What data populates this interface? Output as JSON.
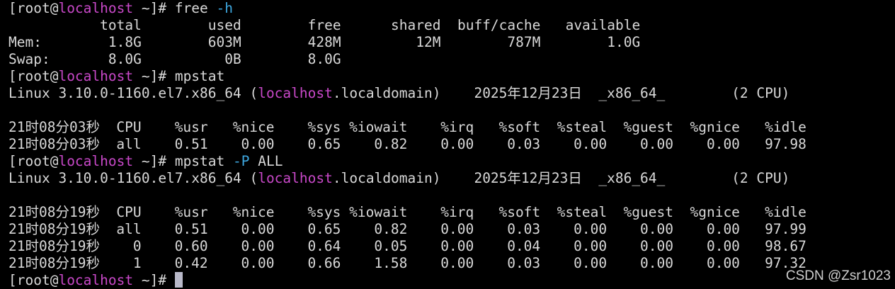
{
  "terminal": {
    "prompt": {
      "open": "[root@",
      "host": "localhost",
      "close": " ~]# "
    },
    "cmd1": {
      "name": "free",
      "flag": " -h"
    },
    "free_table": {
      "header": "           total        used        free      shared  buff/cache   available",
      "rows": [
        "Mem:        1.8G        603M        428M         12M        787M        1.0G",
        "Swap:       8.0G          0B        8.0G"
      ]
    },
    "cmd2": {
      "name": "mpstat"
    },
    "sysinfo": {
      "before": "Linux 3.10.0-1160.el7.x86_64 (",
      "host": "localhost",
      "after": ".localdomain)    2025年12月23日  _x86_64_        (2 CPU)"
    },
    "mpstat1": {
      "header": "21时08分03秒  CPU    %usr   %nice    %sys %iowait    %irq   %soft  %steal  %guest  %gnice   %idle",
      "rows": [
        "21时08分03秒  all    0.51    0.00    0.65    0.82    0.00    0.03    0.00    0.00    0.00   97.98"
      ]
    },
    "cmd3": {
      "name": "mpstat",
      "flag": " -P",
      "arg": " ALL"
    },
    "mpstat2": {
      "header": "21时08分19秒  CPU    %usr   %nice    %sys %iowait    %irq   %soft  %steal  %guest  %gnice   %idle",
      "rows": [
        "21时08分19秒  all    0.51    0.00    0.65    0.82    0.00    0.03    0.00    0.00    0.00   97.99",
        "21时08分19秒    0    0.60    0.00    0.64    0.05    0.00    0.04    0.00    0.00    0.00   98.67",
        "21时08分19秒    1    0.42    0.00    0.66    1.58    0.00    0.03    0.00    0.00    0.00   97.32"
      ]
    },
    "colors": {
      "background": "#000000",
      "text": "#d8d8d8",
      "hostname": "#c848c8",
      "flag": "#3ea8e0",
      "cursor": "#b9b9c9"
    }
  },
  "watermark": "CSDN @Zsr1023"
}
